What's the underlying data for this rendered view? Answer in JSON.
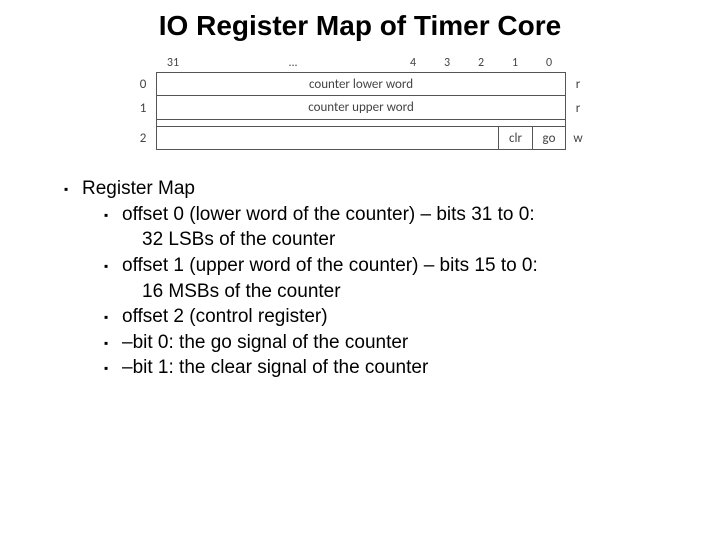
{
  "title": "IO Register Map of Timer Core",
  "diagram": {
    "bit_labels": {
      "b31": "31",
      "ellipsis": "...",
      "b4": "4",
      "b3": "3",
      "b2": "2",
      "b1": "1",
      "b0": "0"
    },
    "rows": [
      {
        "offset": "0",
        "label": "counter lower word",
        "access": "r"
      },
      {
        "offset": "1",
        "label": "counter upper word",
        "access": "r"
      },
      {
        "offset": "2",
        "clr": "clr",
        "go": "go",
        "access": "w"
      }
    ]
  },
  "bullets": {
    "heading": "Register Map",
    "items": [
      "offset 0 (lower word of the counter) – bits 31 to 0:",
      "32 LSBs of the counter",
      "offset 1 (upper word of the counter) – bits 15 to 0:",
      "16 MSBs of the counter",
      "offset 2 (control register)",
      "–bit 0: the go signal of the counter",
      "–bit 1: the clear signal of the counter"
    ]
  }
}
